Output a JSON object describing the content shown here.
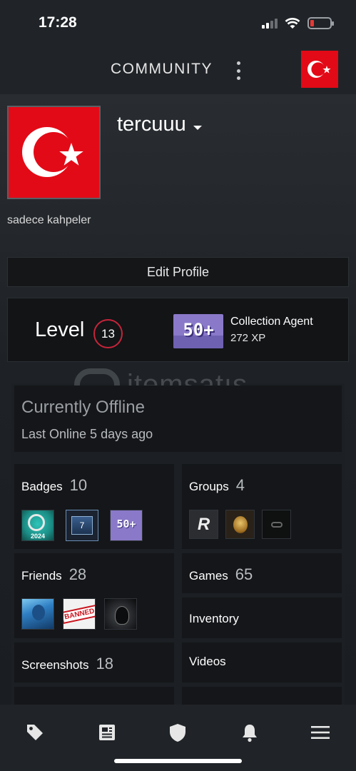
{
  "status_bar": {
    "time": "17:28"
  },
  "header": {
    "title": "COMMUNITY",
    "flag_icon": "turkey-flag-icon",
    "menu_icon": "kebab-menu-icon"
  },
  "profile": {
    "username": "tercuuu",
    "bio": "sadece kahpeler",
    "avatar_icon": "turkey-flag-avatar"
  },
  "edit_profile": {
    "label": "Edit Profile"
  },
  "level": {
    "label": "Level",
    "value": "13",
    "badge_text": "50+",
    "badge_name": "Collection Agent",
    "badge_xp": "272 XP"
  },
  "watermark": {
    "text": "itemsatış"
  },
  "status": {
    "title": "Currently Offline",
    "subtitle": "Last Online 5 days ago"
  },
  "tiles": {
    "badges": {
      "label": "Badges",
      "count": "10"
    },
    "groups": {
      "label": "Groups",
      "count": "4"
    },
    "friends": {
      "label": "Friends",
      "count": "28"
    },
    "games": {
      "label": "Games",
      "count": "65"
    },
    "inventory": {
      "label": "Inventory"
    },
    "screenshots": {
      "label": "Screenshots",
      "count": "18"
    },
    "videos": {
      "label": "Videos"
    }
  },
  "thumb_text": {
    "badge_seven": "7",
    "badge_fifty": "50+",
    "group_r": "R",
    "friend_banned": "BANNED"
  },
  "bottom_nav": [
    {
      "name": "store",
      "icon": "tag-icon"
    },
    {
      "name": "news",
      "icon": "news-icon"
    },
    {
      "name": "guard",
      "icon": "shield-icon"
    },
    {
      "name": "notifications",
      "icon": "bell-icon"
    },
    {
      "name": "menu",
      "icon": "hamburger-menu-icon"
    }
  ],
  "colors": {
    "background": "#1b1f24",
    "header": "#202428",
    "panel": "#141619",
    "level_ring": "#c6243a",
    "badge_purple": "#8a79c9",
    "flag_red": "#e30a17"
  }
}
